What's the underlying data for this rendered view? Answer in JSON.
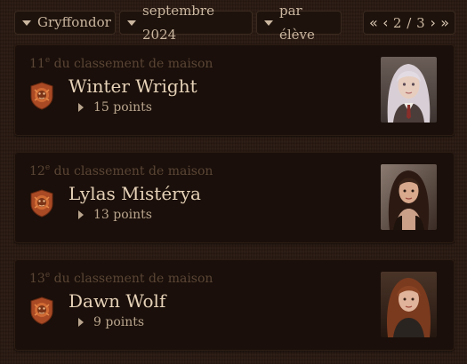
{
  "toolbar": {
    "house_label": "Gryffondor",
    "month_label": "septembre 2024",
    "mode_label": "par élève",
    "pager": {
      "first_icon": "double-chevron-left-icon",
      "prev_icon": "chevron-left-icon",
      "current": "2",
      "separator": "/",
      "total": "3",
      "next_icon": "chevron-right-icon",
      "last_icon": "double-chevron-right-icon"
    }
  },
  "students": [
    {
      "rank_number": "11",
      "rank_suffix": "e",
      "rank_text": "du classement de maison",
      "name": "Winter Wright",
      "points": "15 points",
      "crest_icon": "gryffindor-lion-crest-icon",
      "avatar": "portrait-silver-haired-student"
    },
    {
      "rank_number": "12",
      "rank_suffix": "e",
      "rank_text": "du classement de maison",
      "name": "Lylas Mistérya",
      "points": "13 points",
      "crest_icon": "gryffindor-lion-crest-icon",
      "avatar": "portrait-dark-haired-woman"
    },
    {
      "rank_number": "13",
      "rank_suffix": "e",
      "rank_text": "du classement de maison",
      "name": "Dawn Wolf",
      "points": "9 points",
      "crest_icon": "gryffindor-lion-crest-icon",
      "avatar": "portrait-auburn-haired-woman"
    }
  ],
  "colors": {
    "background": "#2a1a12",
    "card": "#1a0f0a",
    "text": "#cbb7a0",
    "name": "#e6d2b8",
    "rank": "#5a4535",
    "crest": "#b5532a"
  }
}
